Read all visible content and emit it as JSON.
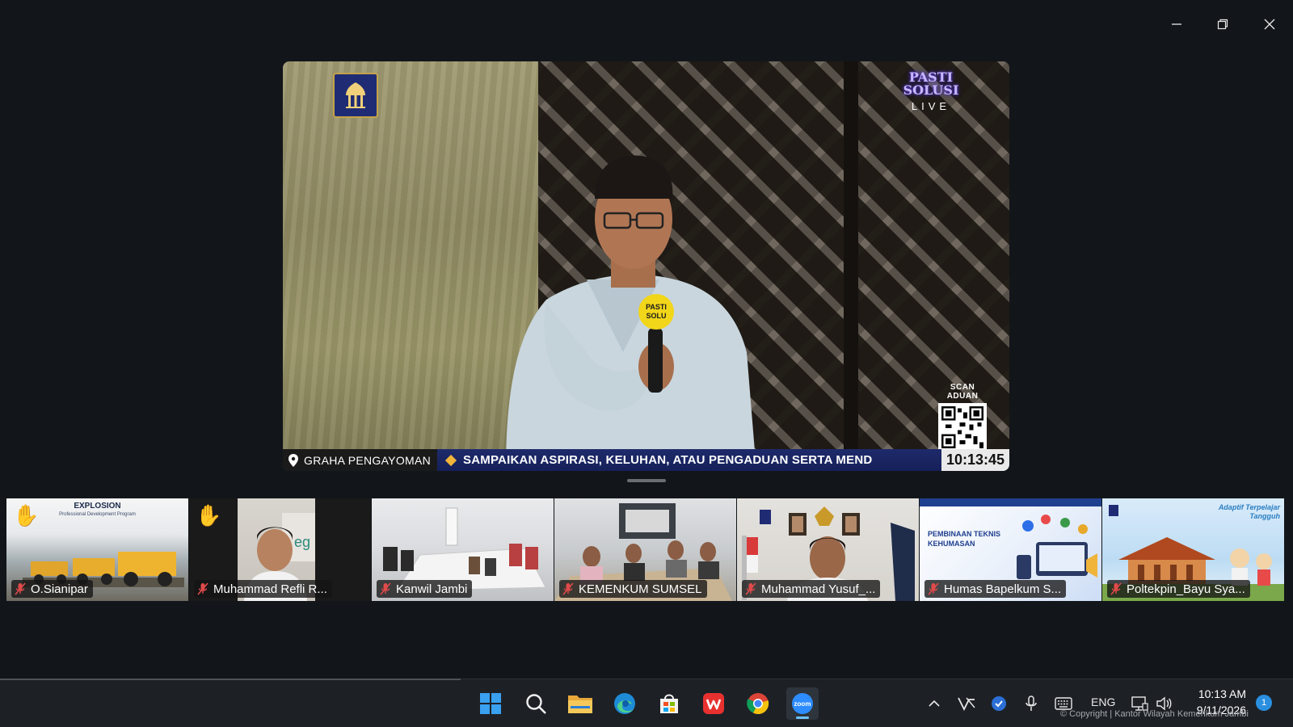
{
  "window": {
    "controls": [
      "minimize",
      "restore",
      "close"
    ]
  },
  "main_video": {
    "live_logo_line1": "PASTI",
    "live_logo_line2": "SOLUSI",
    "live_logo_sub": "LIVE",
    "scan_label": "SCAN ADUAN",
    "ticker_location": "GRAHA PENGAYOMAN",
    "ticker_text": "SAMPAIKAN ASPIRASI, KELUHAN, ATAU PENGADUAN SERTA MEND",
    "ticker_clock": "10:13:45"
  },
  "participants": [
    {
      "name": "O.Sianipar",
      "hand_raised": true,
      "muted": true,
      "slide_title": "EXPLOSION",
      "slide_subtitle": "Professional Development Program"
    },
    {
      "name": "Muhammad Refli R...",
      "hand_raised": true,
      "muted": true
    },
    {
      "name": "Kanwil Jambi",
      "hand_raised": false,
      "muted": true
    },
    {
      "name": "KEMENKUM SUMSEL",
      "hand_raised": false,
      "muted": true
    },
    {
      "name": "Muhammad Yusuf_...",
      "hand_raised": false,
      "muted": true
    },
    {
      "name": "Humas Bapelkum S...",
      "hand_raised": false,
      "muted": true,
      "slide_title": "PEMBINAAN TEKNIS KEHUMASAN"
    },
    {
      "name": "Poltekpin_Bayu Sya...",
      "hand_raised": false,
      "muted": true,
      "slide_title": "Adaptif Terpelajar Tangguh"
    }
  ],
  "taskbar": {
    "apps": [
      "start",
      "search",
      "file-explorer",
      "edge",
      "store",
      "wps",
      "chrome",
      "zoom"
    ],
    "zoom_label": "zoom",
    "language": "ENG",
    "time": "10:13 AM",
    "date": "9/11/2026",
    "notification_count": "1"
  },
  "watermark": "© Copyright | Kantor Wilayah Kemenkum Jambi",
  "colors": {
    "background": "#12161a",
    "taskbar": "#1d2126",
    "ticker": "#1e2a6a",
    "zoom_blue": "#2d8cff",
    "hand_yellow": "#f5c23b",
    "mute_red": "#e04a4a"
  }
}
